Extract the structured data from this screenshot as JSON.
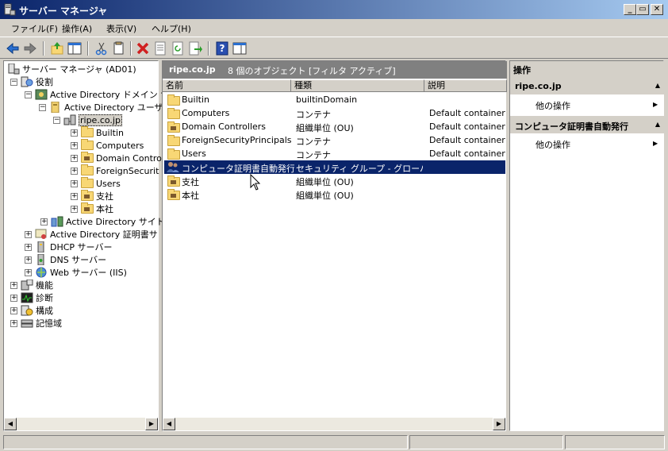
{
  "window": {
    "title": "サーバー マネージャ",
    "minimize": "_",
    "restore": "▭",
    "close": "✕"
  },
  "menu": [
    "ファイル(F)",
    "操作(A)",
    "表示(V)",
    "ヘルプ(H)"
  ],
  "toolbar": {
    "icons": [
      "back-icon",
      "forward-icon",
      "up-folder-icon",
      "show-hide-tree-icon",
      "cut-icon",
      "copy-icon",
      "delete-icon",
      "properties-icon",
      "refresh-icon",
      "export-icon",
      "help-icon",
      "action-pane-icon"
    ]
  },
  "tree": {
    "items": [
      {
        "label": "サーバー マネージャ (AD01)",
        "expander": ""
      },
      {
        "label": "役割",
        "expander": "−"
      },
      {
        "label": "Active Directory ドメイン サ",
        "expander": "−"
      },
      {
        "label": "Active Directory ユーザ",
        "expander": "−"
      },
      {
        "label": "ripe.co.jp",
        "expander": "−"
      },
      {
        "label": "Builtin",
        "expander": "+"
      },
      {
        "label": "Computers",
        "expander": "+"
      },
      {
        "label": "Domain Contro",
        "expander": "+"
      },
      {
        "label": "ForeignSecurit",
        "expander": "+"
      },
      {
        "label": "Users",
        "expander": "+"
      },
      {
        "label": "支社",
        "expander": "+"
      },
      {
        "label": "本社",
        "expander": "+"
      },
      {
        "label": "Active Directory サイト",
        "expander": "+"
      },
      {
        "label": "Active Directory 証明書サ",
        "expander": "+"
      },
      {
        "label": "DHCP サーバー",
        "expander": "+"
      },
      {
        "label": "DNS サーバー",
        "expander": "+"
      },
      {
        "label": "Web サーバー (IIS)",
        "expander": "+"
      },
      {
        "label": "機能",
        "expander": "+"
      },
      {
        "label": "診断",
        "expander": "+"
      },
      {
        "label": "構成",
        "expander": "+"
      },
      {
        "label": "記憶域",
        "expander": "+"
      }
    ]
  },
  "list": {
    "title": "ripe.co.jp",
    "object_count": "8 個のオブジェクト [フィルタ アクティブ]",
    "columns": [
      "名前",
      "種類",
      "説明"
    ],
    "rows": [
      {
        "name": "Builtin",
        "type": "builtinDomain",
        "desc": ""
      },
      {
        "name": "Computers",
        "type": "コンテナ",
        "desc": "Default container fo"
      },
      {
        "name": "Domain Controllers",
        "type": "組織単位 (OU)",
        "desc": "Default container fo"
      },
      {
        "name": "ForeignSecurityPrincipals",
        "type": "コンテナ",
        "desc": "Default container fo"
      },
      {
        "name": "Users",
        "type": "コンテナ",
        "desc": "Default container fo"
      },
      {
        "name": "コンピュータ証明書自動発行",
        "type": "セキュリティ グループ - グローバル",
        "desc": ""
      },
      {
        "name": "支社",
        "type": "組織単位 (OU)",
        "desc": ""
      },
      {
        "name": "本社",
        "type": "組織単位 (OU)",
        "desc": ""
      }
    ]
  },
  "actions": {
    "header": "操作",
    "sections": [
      {
        "title": "ripe.co.jp",
        "item": "他の操作",
        "collapse": "▲",
        "arrow": "▶"
      },
      {
        "title": "コンピュータ証明書自動発行",
        "item": "他の操作",
        "collapse": "▲",
        "arrow": "▶"
      }
    ]
  },
  "scroll": {
    "left": "◀",
    "right": "▶"
  }
}
